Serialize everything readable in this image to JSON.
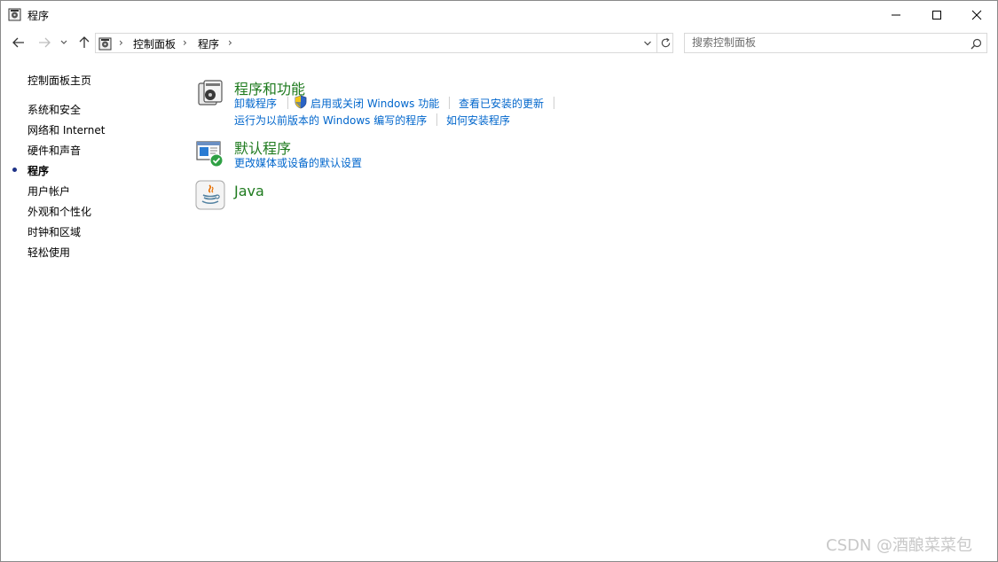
{
  "window": {
    "title": "程序"
  },
  "address": {
    "crumbs": [
      "控制面板",
      "程序"
    ]
  },
  "search": {
    "placeholder": "搜索控制面板"
  },
  "sidebar": {
    "items": [
      {
        "label": "控制面板主页"
      },
      {
        "label": "系统和安全"
      },
      {
        "label": "网络和 Internet"
      },
      {
        "label": "硬件和声音"
      },
      {
        "label": "程序",
        "active": true
      },
      {
        "label": "用户帐户"
      },
      {
        "label": "外观和个性化"
      },
      {
        "label": "时钟和区域"
      },
      {
        "label": "轻松使用"
      }
    ]
  },
  "categories": [
    {
      "title": "程序和功能",
      "icon": "programs-features-icon",
      "links": [
        "卸载程序",
        "启用或关闭 Windows 功能",
        "查看已安装的更新",
        "运行为以前版本的 Windows 编写的程序",
        "如何安装程序"
      ]
    },
    {
      "title": "默认程序",
      "icon": "default-programs-icon",
      "links": [
        "更改媒体或设备的默认设置"
      ]
    },
    {
      "title": "Java",
      "icon": "java-icon",
      "links": []
    }
  ],
  "watermark": "CSDN @酒酿菜菜包",
  "colors": {
    "category_title": "#1e7a1e",
    "link": "#0066cc",
    "active_bullet": "#1e3287"
  }
}
